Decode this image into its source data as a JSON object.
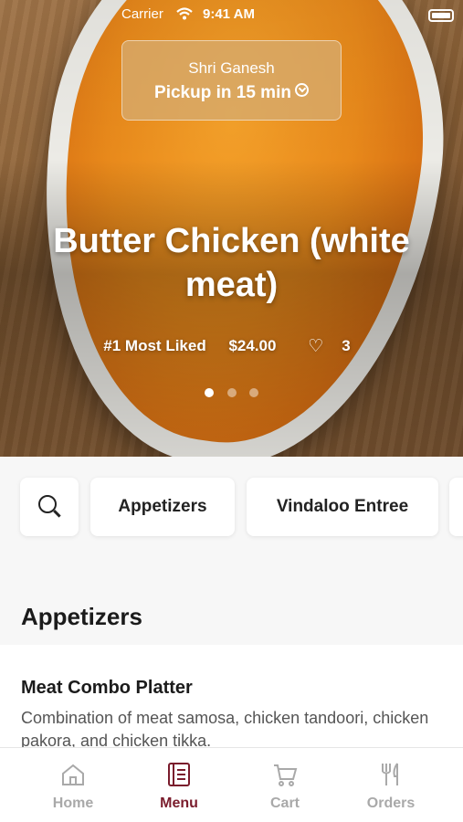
{
  "status_bar": {
    "carrier": "Carrier",
    "time": "9:41 AM"
  },
  "store": {
    "name": "Shri Ganesh",
    "pickup": "Pickup in 15 min"
  },
  "featured": {
    "title": "Butter Chicken (white meat)",
    "badge": "#1 Most Liked",
    "price": "$24.00",
    "likes": "3",
    "carousel_count": 3,
    "carousel_active": 1
  },
  "categories": {
    "items": [
      "Appetizers",
      "Vindaloo Entree"
    ]
  },
  "section": {
    "title": "Appetizers"
  },
  "menu_item": {
    "name": "Meat Combo Platter",
    "description": "Combination of meat samosa, chicken tandoori, chicken pakora, and chicken tikka."
  },
  "tabs": [
    {
      "label": "Home",
      "icon": "home-icon"
    },
    {
      "label": "Menu",
      "icon": "menu-icon"
    },
    {
      "label": "Cart",
      "icon": "cart-icon"
    },
    {
      "label": "Orders",
      "icon": "orders-icon"
    }
  ],
  "colors": {
    "accent": "#7a1c2c",
    "inactive_tab": "#a9a9a9"
  }
}
